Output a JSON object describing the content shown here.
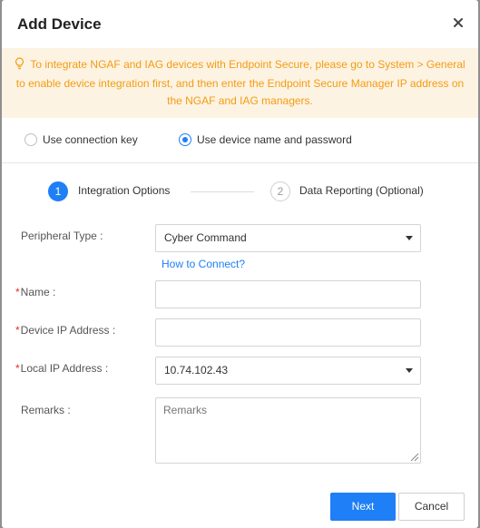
{
  "dialog": {
    "title": "Add Device",
    "close_icon": "close-icon"
  },
  "notice": {
    "icon": "lightbulb-icon",
    "text": "To integrate NGAF and IAG devices with Endpoint Secure, please go to System > General to enable device integration first, and then enter the Endpoint Secure Manager IP address on the NGAF and IAG managers."
  },
  "connection_mode": {
    "options": [
      {
        "label": "Use connection key",
        "selected": false
      },
      {
        "label": "Use device name and password",
        "selected": true
      }
    ]
  },
  "steps": [
    {
      "number": "1",
      "label": "Integration Options",
      "active": true
    },
    {
      "number": "2",
      "label": "Data Reporting (Optional)",
      "active": false
    }
  ],
  "form": {
    "peripheral_type": {
      "label": "Peripheral Type :",
      "value": "Cyber Command"
    },
    "how_to_connect": "How to Connect?",
    "name": {
      "required_mark": "*",
      "label": "Name :",
      "value": ""
    },
    "device_ip": {
      "required_mark": "*",
      "label": "Device IP Address :",
      "value": ""
    },
    "local_ip": {
      "required_mark": "*",
      "label": "Local IP Address :",
      "value": "10.74.102.43"
    },
    "remarks": {
      "label": "Remarks :",
      "value": "",
      "placeholder": "Remarks"
    }
  },
  "footer": {
    "next_label": "Next",
    "cancel_label": "Cancel"
  },
  "colors": {
    "accent": "#1e7ff6",
    "notice_text": "#f39c12",
    "notice_bg": "#fdf3e3",
    "required": "#e0301e"
  }
}
